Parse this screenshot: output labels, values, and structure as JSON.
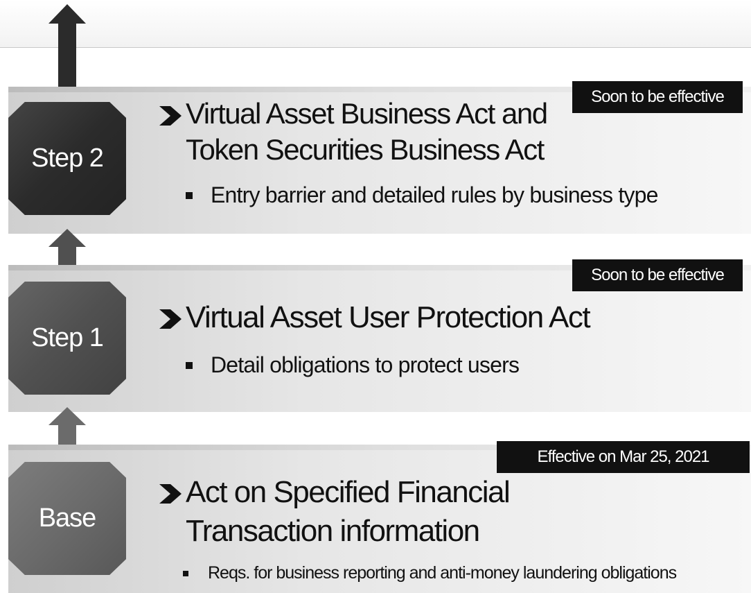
{
  "colors": {
    "step2_box": "#2b2b2b",
    "step1_box": "#505050",
    "base_box": "#6b6b6b",
    "badge_bg": "#111111",
    "panel_light": "#f7f7f7"
  },
  "steps": [
    {
      "label": "Step 2",
      "title_line1": "Virtual Asset Business Act and",
      "title_line2": "Token Securities Business Act",
      "bullet": "Entry barrier and detailed rules by business type",
      "badge": "Soon to be effective"
    },
    {
      "label": "Step 1",
      "title_line1": "Virtual Asset User Protection Act",
      "bullet": "Detail obligations to protect users",
      "badge": "Soon to be effective"
    },
    {
      "label": "Base",
      "title_line1": "Act on Specified Financial",
      "title_line2": "Transaction information",
      "bullet": "Reqs. for business reporting and anti-money laundering obligations",
      "badge": "Effective on Mar 25, 2021"
    }
  ]
}
